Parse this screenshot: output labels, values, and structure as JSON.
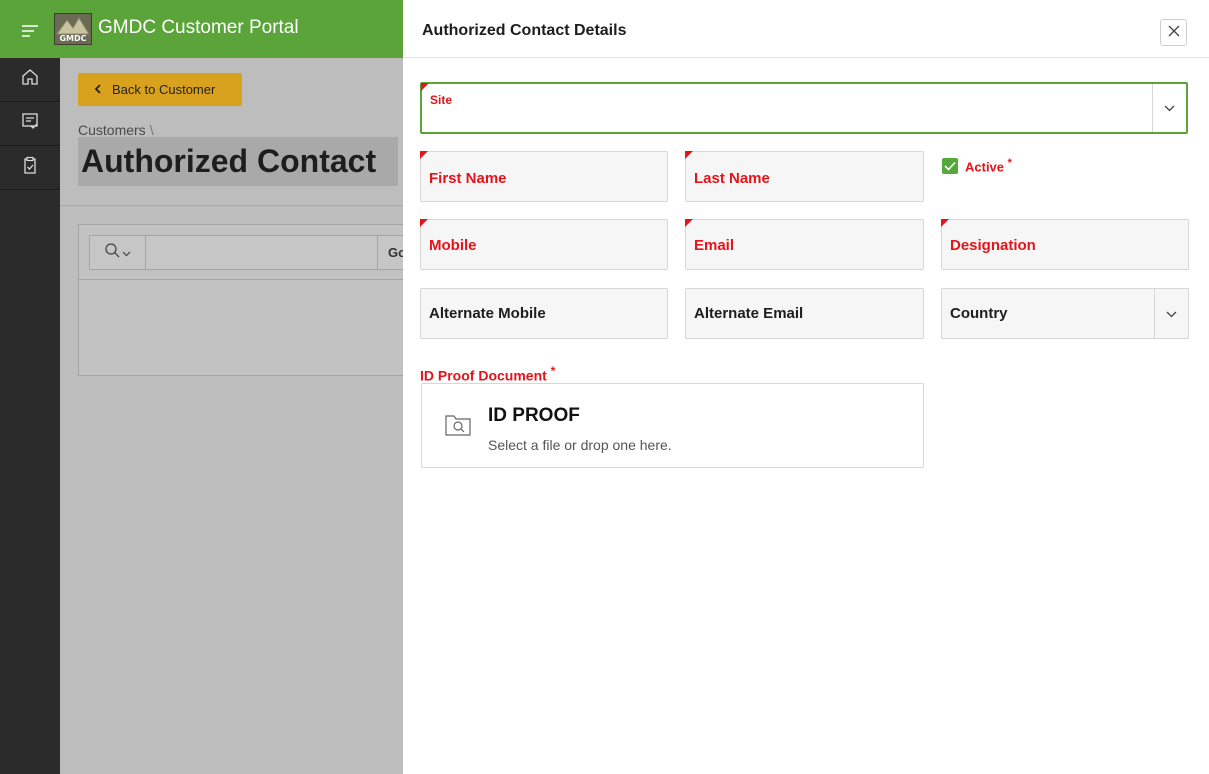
{
  "header": {
    "app_title": "GMDC Customer Portal",
    "logo_text": "GMDC",
    "menu_icon": "hamburger-icon"
  },
  "nav": {
    "items": [
      {
        "icon": "home-icon"
      },
      {
        "icon": "checklist-icon"
      },
      {
        "icon": "clipboard-check-icon"
      }
    ]
  },
  "page": {
    "back_button": "Back to Customer",
    "breadcrumb": "Customers",
    "breadcrumb_separator": "\\",
    "title": "Authorized Contact",
    "search": {
      "go_label": "Go"
    }
  },
  "drawer": {
    "title": "Authorized Contact Details",
    "fields": {
      "site": "Site",
      "first_name": "First Name",
      "last_name": "Last Name",
      "active": "Active",
      "mobile": "Mobile",
      "email": "Email",
      "designation": "Designation",
      "alternate_mobile": "Alternate Mobile",
      "alternate_email": "Alternate Email",
      "country": "Country"
    },
    "required_marker": "*",
    "id_proof": {
      "label": "ID Proof Document",
      "title": "ID PROOF",
      "hint": "Select a file or drop one here."
    }
  },
  "colors": {
    "brand_green": "#5aa43a",
    "required_red": "#e3141b",
    "back_button": "#d9a21e",
    "nav_dark": "#2b2b2b"
  }
}
